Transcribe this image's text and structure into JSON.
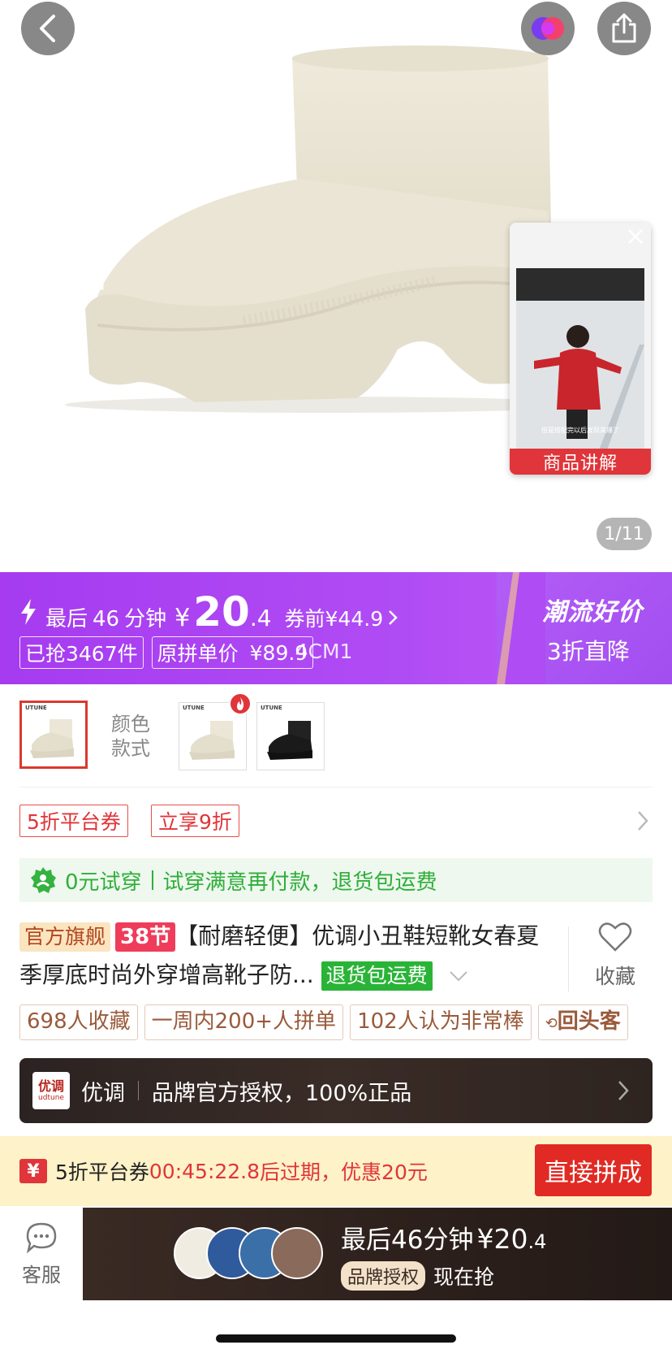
{
  "hero": {
    "page_indicator": "1/11",
    "video_label": "商品讲解",
    "video_caption": "但是搭配完以后发现美爆了"
  },
  "flash": {
    "prefix": "最后",
    "minutes": "46",
    "minutes_unit": "分钟",
    "currency": "¥",
    "price_int": "20",
    "price_dec": ".4",
    "before_coupon": "券前¥44.9",
    "sold": "已抢3467件",
    "orig_label": "原拼单价",
    "orig_price": "¥89.9",
    "orig_overlay": "4CM1",
    "promo_title": "潮流好价",
    "promo_sub": "3折直降"
  },
  "variants": {
    "label_line1": "颜色",
    "label_line2": "款式",
    "brand_mark": "UTUNE"
  },
  "coupons": {
    "items": [
      "5折平台券",
      "立享9折"
    ]
  },
  "trial": {
    "text_a": "0元试穿",
    "text_b": "试穿满意再付款，退货包运费"
  },
  "product": {
    "tag_official": "官方旗舰",
    "tag_38": "38节",
    "title": "【耐磨轻便】优调小丑鞋短靴女春夏季厚底时尚外穿增高靴子防...",
    "tag_return": "退货包运费",
    "fav_label": "收藏"
  },
  "stats": [
    "698人收藏",
    "一周内200+人拼单",
    "102人认为非常棒",
    "回头客"
  ],
  "brand": {
    "logo_cn": "优调",
    "logo_en": "udtune",
    "name": "优调",
    "desc": "品牌官方授权，100%正品"
  },
  "expire": {
    "coupon_icon": "¥",
    "coupon_name": "5折平台券",
    "countdown": "00:45:22.8",
    "suffix": "后过期，优惠20元",
    "button": "直接拼成"
  },
  "bottom": {
    "service_label": "客服",
    "cta_line1_prefix": "最后46分钟",
    "cta_price": "¥20",
    "cta_price_dec": ".4",
    "cta_badge": "品牌授权",
    "cta_action": "现在抢"
  },
  "colors": {
    "accent_red": "#e0353a",
    "purple": "#a63bf0",
    "green": "#2fae3a"
  }
}
